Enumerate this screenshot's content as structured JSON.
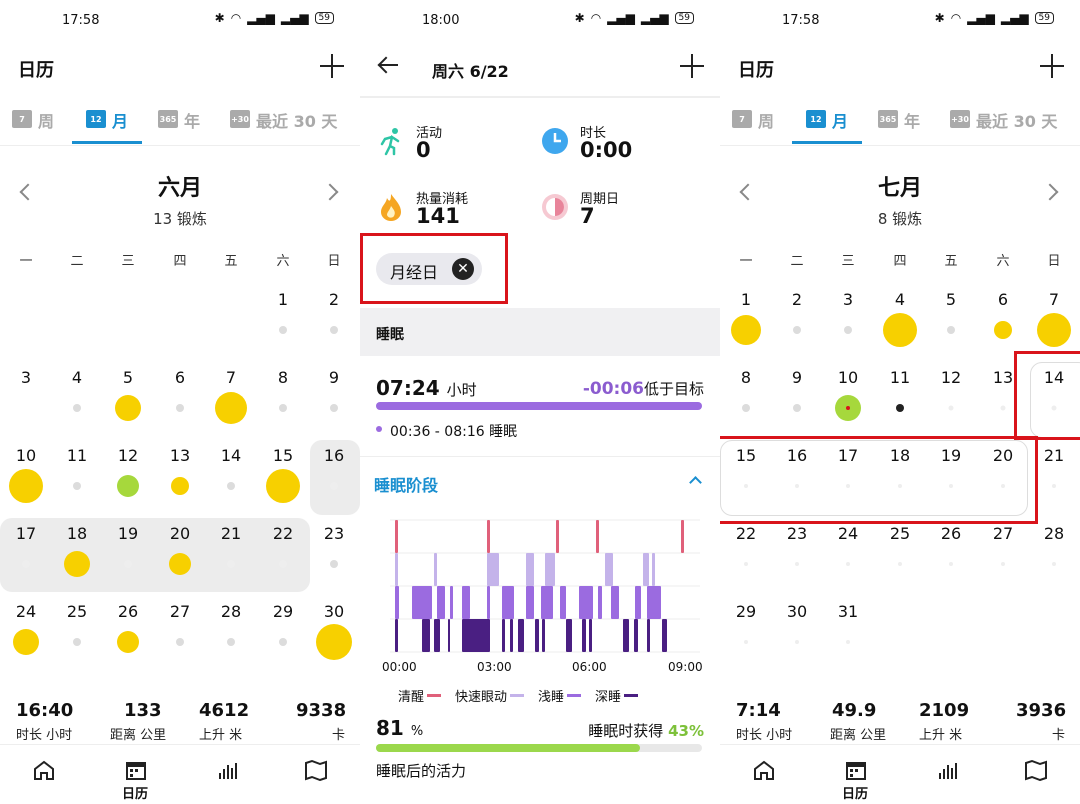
{
  "panels": [
    {
      "status_time": "17:58",
      "battery": "59",
      "title": "日历",
      "tabs": [
        {
          "icon": "7",
          "label": "周"
        },
        {
          "icon": "12",
          "label": "月"
        },
        {
          "icon": "365",
          "label": "年"
        },
        {
          "icon": "+30",
          "label": "最近 30 天"
        }
      ],
      "month": "六月",
      "workouts": "13 锻炼",
      "weekdays": [
        "一",
        "二",
        "三",
        "四",
        "五",
        "六",
        "日"
      ],
      "stats": [
        {
          "value": "16:40",
          "label": "时长 小时"
        },
        {
          "value": "133",
          "label": "距离 公里"
        },
        {
          "value": "4612",
          "label": "上升 米"
        },
        {
          "value": "9338",
          "label": "卡"
        }
      ],
      "nav_label": "日历"
    },
    {
      "status_time": "18:00",
      "battery": "59",
      "title": "周六 6/22",
      "metrics": [
        {
          "label": "活动",
          "value": "0"
        },
        {
          "label": "时长",
          "value": "0:00"
        },
        {
          "label": "热量消耗",
          "value": "141"
        },
        {
          "label": "周期日",
          "value": "7"
        }
      ],
      "chip": "月经日",
      "section_sleep": "睡眠",
      "sleep_hours": "07:24",
      "sleep_unit": "小时",
      "sleep_diff": "-00:06",
      "sleep_diff_label": "低于目标",
      "sleep_range": "00:36 - 08:16 睡眠",
      "stages_title": "睡眠阶段",
      "x_ticks": [
        "00:00",
        "03:00",
        "06:00",
        "09:00"
      ],
      "legend": [
        {
          "label": "清醒",
          "color": "#e0607a"
        },
        {
          "label": "快速眼动",
          "color": "#c4b3ea"
        },
        {
          "label": "浅睡",
          "color": "#9b6be0"
        },
        {
          "label": "深睡",
          "color": "#4a1f82"
        }
      ],
      "vitality_pct": "81",
      "vitality_unit": "%",
      "gain_label": "睡眠时获得",
      "gain_value": "43%",
      "vitality_label": "睡眠后的活力"
    },
    {
      "status_time": "17:58",
      "battery": "59",
      "title": "日历",
      "tabs": [
        {
          "icon": "7",
          "label": "周"
        },
        {
          "icon": "12",
          "label": "月"
        },
        {
          "icon": "365",
          "label": "年"
        },
        {
          "icon": "+30",
          "label": "最近 30 天"
        }
      ],
      "month": "七月",
      "workouts": "8 锻炼",
      "weekdays": [
        "一",
        "二",
        "三",
        "四",
        "五",
        "六",
        "日"
      ],
      "stats": [
        {
          "value": "7:14",
          "label": "时长 小时"
        },
        {
          "value": "49.9",
          "label": "距离 公里"
        },
        {
          "value": "2109",
          "label": "上升 米"
        },
        {
          "value": "3936",
          "label": "卡"
        }
      ],
      "nav_label": "日历"
    }
  ],
  "june_days": [
    [
      "",
      "",
      "",
      "",
      "",
      "1",
      "2"
    ],
    [
      "3",
      "4",
      "5",
      "6",
      "7",
      "8",
      "9"
    ],
    [
      "10",
      "11",
      "12",
      "13",
      "14",
      "15",
      "16"
    ],
    [
      "17",
      "18",
      "19",
      "20",
      "21",
      "22",
      "23"
    ],
    [
      "24",
      "25",
      "26",
      "27",
      "28",
      "29",
      "30"
    ]
  ],
  "july_days": [
    [
      "1",
      "2",
      "3",
      "4",
      "5",
      "6",
      "7"
    ],
    [
      "8",
      "9",
      "10",
      "11",
      "12",
      "13",
      "14"
    ],
    [
      "15",
      "16",
      "17",
      "18",
      "19",
      "20",
      "21"
    ],
    [
      "22",
      "23",
      "24",
      "25",
      "26",
      "27",
      "28"
    ],
    [
      "29",
      "30",
      "31",
      "",
      "",
      "",
      ""
    ]
  ],
  "colors": {
    "accent": "#1a8fd0",
    "workout": "#f7d000",
    "cycle": "#a6d83c",
    "highlight": "#d9141b"
  }
}
